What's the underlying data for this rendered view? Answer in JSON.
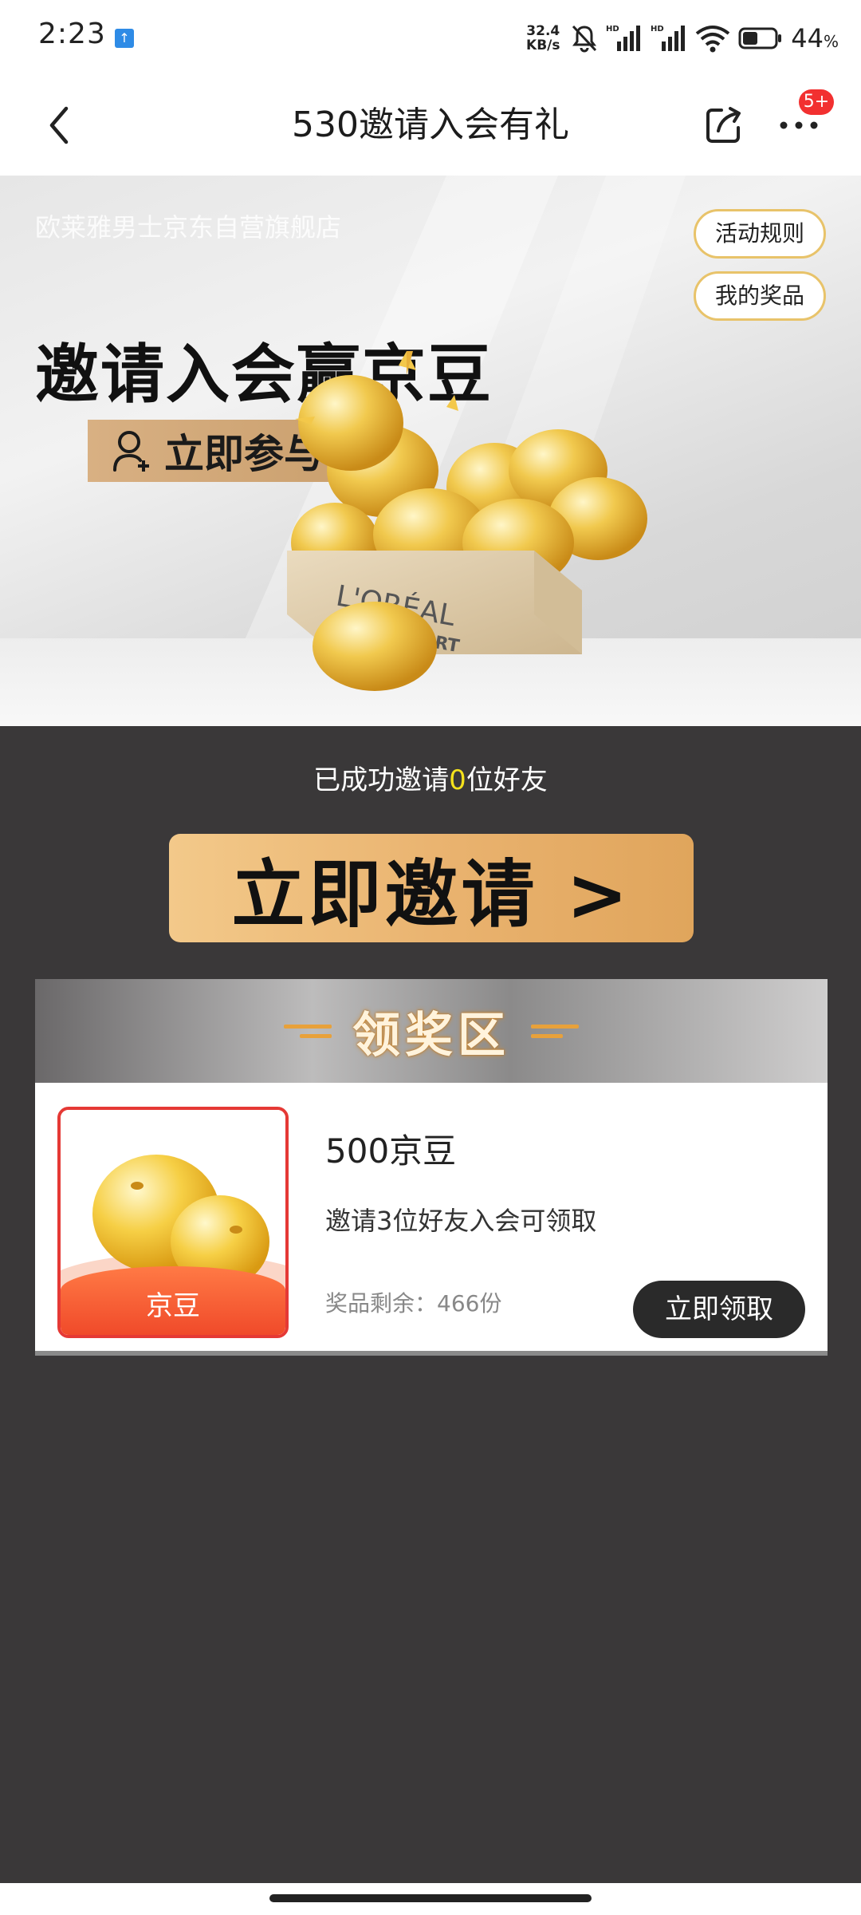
{
  "status_bar": {
    "time": "2:23",
    "net_speed_value": "32.4",
    "net_speed_unit": "KB/s",
    "battery_percent": "44",
    "battery_unit": "%"
  },
  "nav": {
    "title": "530邀请入会有礼",
    "badge": "5+"
  },
  "banner": {
    "shop_name": "欧莱雅男士京东自营旗舰店",
    "headline": "邀请入会赢京豆",
    "join_label": "立即参与 >",
    "rules_label": "活动规则",
    "my_prizes_label": "我的奖品",
    "brand_line1": "L'ORÉAL",
    "brand_line2": "MEN EXPERT"
  },
  "invite": {
    "prefix": "已成功邀请",
    "count": "0",
    "suffix": "位好友",
    "button_label": "立即邀请 >"
  },
  "prize_section": {
    "title": "领奖区",
    "items": [
      {
        "name": "500京豆",
        "condition": "邀请3位好友入会可领取",
        "remaining": "奖品剩余：466份",
        "image_label": "京豆",
        "button_label": "立即领取"
      }
    ]
  },
  "colors": {
    "accent_gold": "#e9b26e",
    "page_bg": "#3a3839",
    "count_yellow": "#f5e21c",
    "badge_red": "#f23030"
  }
}
